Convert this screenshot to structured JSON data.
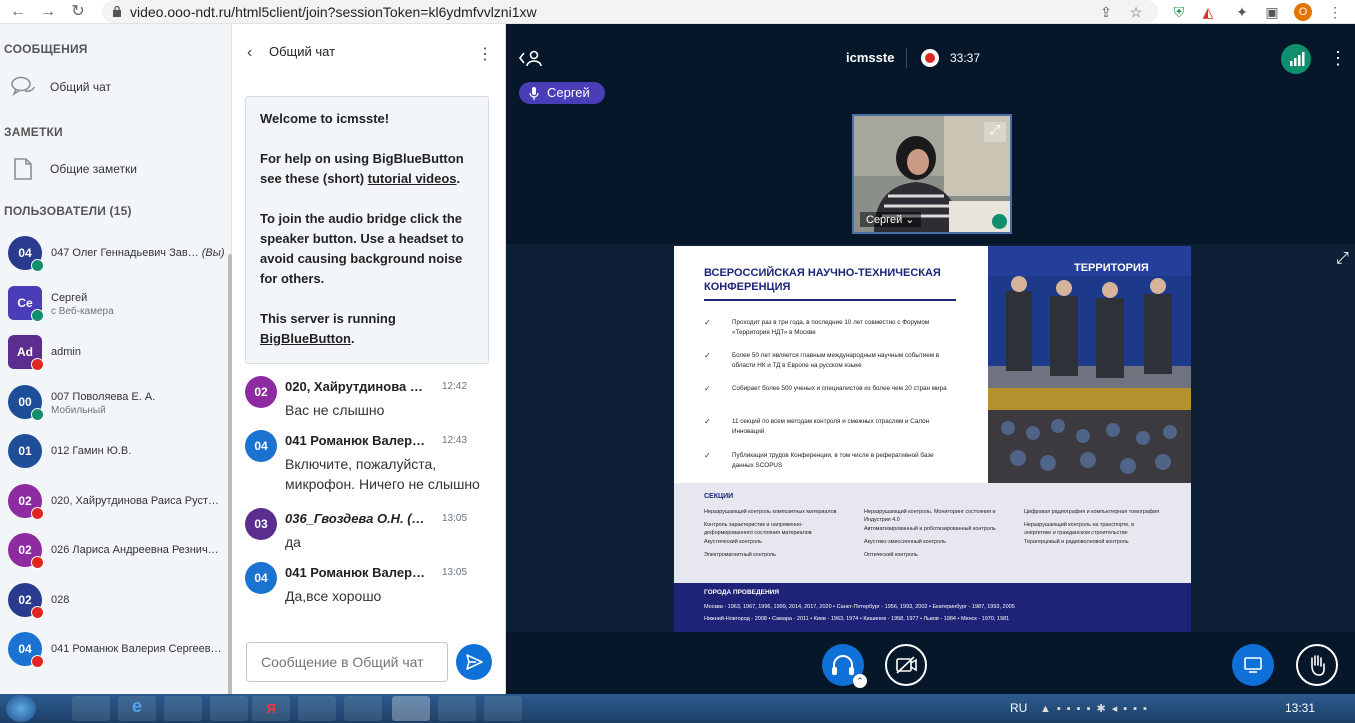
{
  "browser": {
    "url": "video.ooo-ndt.ru/html5client/join?sessionToken=kl6ydmfvvlzni1xw",
    "profile_initial": "O"
  },
  "sidebar": {
    "messages_heading": "СООБЩЕНИЯ",
    "public_chat_label": "Общий чат",
    "notes_heading": "ЗАМЕТКИ",
    "shared_notes_label": "Общие заметки",
    "users_heading": "ПОЛЬЗОВАТЕЛИ (15)",
    "users": [
      {
        "initials": "04",
        "name": "047 Олег Геннадьевич Зав…",
        "you": "(Вы)",
        "sub": "",
        "color": "#2a3a8e",
        "badge": "green"
      },
      {
        "initials": "Се",
        "name": "Сергей",
        "you": "",
        "sub": "с Веб-камера",
        "color": "#4a3db8",
        "badge": "green"
      },
      {
        "initials": "Ad",
        "name": "admin",
        "you": "",
        "sub": "",
        "color": "#5a2d8e",
        "badge": "red"
      },
      {
        "initials": "00",
        "name": "007 Поволяева Е. А.",
        "you": "",
        "sub": "Мобильный",
        "color": "#1f4e99",
        "badge": "green"
      },
      {
        "initials": "01",
        "name": "012 Гамин Ю.В.",
        "you": "",
        "sub": "",
        "color": "#1f4e99",
        "badge": ""
      },
      {
        "initials": "02",
        "name": "020, Хайрутдинова Раиса Руст…",
        "you": "",
        "sub": "",
        "color": "#8e2ba0",
        "badge": "red"
      },
      {
        "initials": "02",
        "name": "026 Лариса Андреевна Резнич…",
        "you": "",
        "sub": "",
        "color": "#8e2ba0",
        "badge": "red"
      },
      {
        "initials": "02",
        "name": "028",
        "you": "",
        "sub": "",
        "color": "#2a3a8e",
        "badge": "red"
      },
      {
        "initials": "04",
        "name": "041 Романюк Валерия Сергеев…",
        "you": "",
        "sub": "",
        "color": "#1a72d1",
        "badge": "red"
      }
    ]
  },
  "chat": {
    "title": "Общий чат",
    "welcome": {
      "line1": "Welcome to icmsste!",
      "line2a": "For help on using BigBlueButton see these (short) ",
      "line2link": "tutorial videos",
      "line2b": ".",
      "line3": "To join the audio bridge click the speaker button. Use a headset to avoid causing background noise for others.",
      "line4a": "This server is running ",
      "line4link": "BigBlueButton",
      "line4b": "."
    },
    "messages": [
      {
        "initials": "02",
        "name": "020, Хайрутдинова …",
        "time": "12:42",
        "text": "Вас не слышно",
        "color": "#8e2ba0",
        "italic": false
      },
      {
        "initials": "04",
        "name": "041 Романюк Валер…",
        "time": "12:43",
        "text": "Включите, пожалуйста, микрофон. Ничего не слышно",
        "color": "#1a72d1",
        "italic": false
      },
      {
        "initials": "03",
        "name": "036_Гвоздева О.Н. (…",
        "time": "13:05",
        "text": "да",
        "color": "#5a2d8e",
        "italic": true
      },
      {
        "initials": "04",
        "name": "041 Романюк Валер…",
        "time": "13:05",
        "text": "Да,все хорошо",
        "color": "#1a72d1",
        "italic": false
      }
    ],
    "input_placeholder": "Сообщение в Общий чат"
  },
  "main": {
    "session_name": "icmsste",
    "timer": "33:37",
    "talking_user": "Сергей",
    "webcam_label": "Сергей"
  },
  "slide": {
    "title": "ВСЕРОССИЙСКАЯ НАУЧНО-ТЕХНИЧЕСКАЯ КОНФЕРЕНЦИЯ",
    "bullets": [
      "Проходит раз в три года, в последние 10 лет совместно с Форумом «Территория НДТ» в Москве",
      "Более 50 лет является главным международным научным событием в области НК и ТД в Европе на русском языке",
      "Собирает более 500 ученых и специалистов из более чем 20 стран мира",
      "11 секций по всем методам контроля и смежных отраслям и Салон Инноваций",
      "Публикация трудов Конференции, в том числе в реферативной базе данных SCOPUS"
    ],
    "sections_heading": "СЕКЦИИ",
    "sections": [
      [
        "Неразрушающий контроль композитных материалов",
        "Контроль характеристик и напряженно-деформированного состояния материалов",
        "Акустический контроль",
        "Электромагнитный контроль"
      ],
      [
        "Неразрушающий контроль. Мониторинг состояния и Индустрия 4.0",
        "Автоматизированный и роботизированный контроль",
        "Акустико-эмиссионный контроль",
        "Оптический контроль"
      ],
      [
        "Цифровая радиография и компьютерная томография",
        "Неразрушающий контроль на транспорте, в энергетике и гражданском строительстве",
        "Терагерцовый и радиоволновой контроль"
      ]
    ],
    "cities_heading": "ГОРОДА ПРОВЕДЕНИЯ",
    "cities_line1": "Москва - 1963, 1967, 1996, 1999, 2014, 2017, 2020   •   Санкт-Петербург - 1956, 1993, 2002   •   Екатеринбург - 1987, 1993, 2005",
    "cities_line2": "Нижний-Новгород - 2008   •   Самара - 2011   •   Киев - 1963, 1974   •   Кишинев - 1958, 1977   •   Львов - 1984   •   Минск - 1970, 1981",
    "banner_text": "ТЕРРИТОРИЯ"
  },
  "taskbar": {
    "lang": "RU",
    "time": "13:31"
  }
}
